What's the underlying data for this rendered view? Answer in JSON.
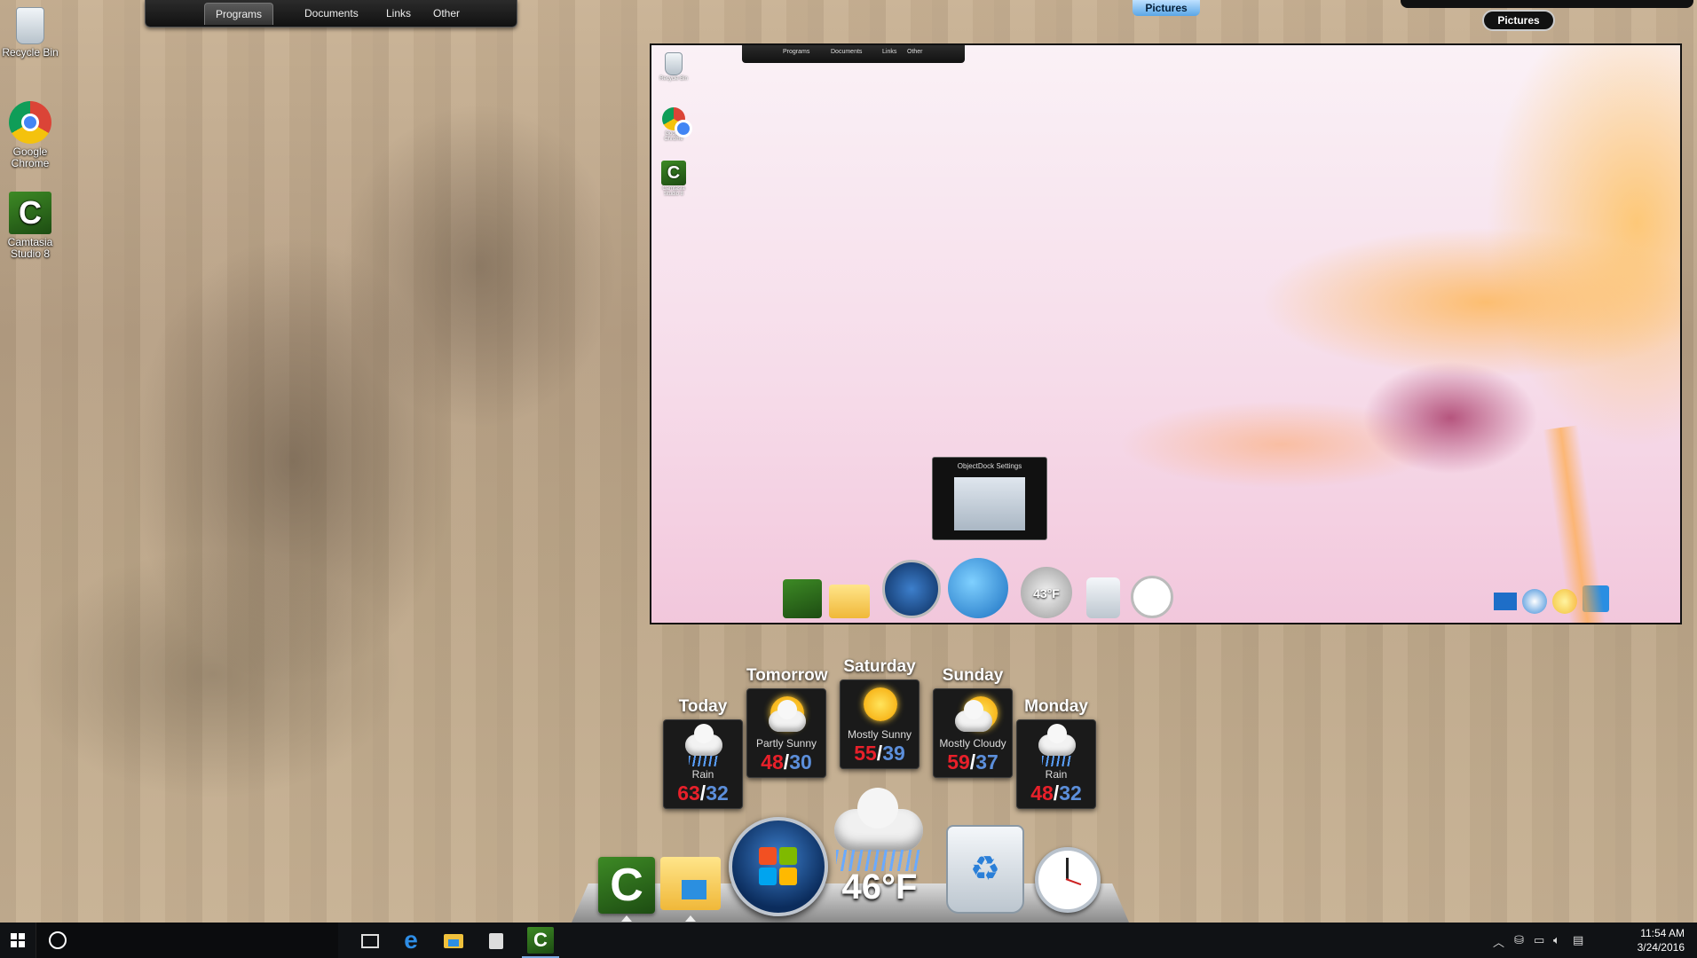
{
  "desktop": {
    "icons": [
      {
        "label": "Recycle Bin",
        "icon": "recycle-bin-icon"
      },
      {
        "label": "Google Chrome",
        "icon": "chrome-icon"
      },
      {
        "label": "Camtasia Studio 8",
        "icon": "camtasia-icon"
      }
    ]
  },
  "top_tabs": [
    "Programs",
    "Documents",
    "Links",
    "Other"
  ],
  "top_right": {
    "pictures_tab": "Pictures",
    "pictures_pill": "Pictures"
  },
  "preview": {
    "mini_tabs": [
      "Programs",
      "Documents",
      "Links",
      "Other"
    ],
    "mini_icons": [
      "Recycle Bin",
      "Google Chrome",
      "Camtasia Studio 8"
    ],
    "tooltip": "ObjectDock Settings",
    "mini_dock_temp": "43°F"
  },
  "forecast": [
    {
      "day": "Today",
      "condition": "Rain",
      "high": "63",
      "low": "32",
      "icon": "rain"
    },
    {
      "day": "Tomorrow",
      "condition": "Partly Sunny",
      "high": "48",
      "low": "30",
      "icon": "partly-sunny"
    },
    {
      "day": "Saturday",
      "condition": "Mostly Sunny",
      "high": "55",
      "low": "39",
      "icon": "sunny"
    },
    {
      "day": "Sunday",
      "condition": "Mostly Cloudy",
      "high": "59",
      "low": "37",
      "icon": "mostly-cloudy"
    },
    {
      "day": "Monday",
      "condition": "Rain",
      "high": "48",
      "low": "32",
      "icon": "rain"
    }
  ],
  "dock": {
    "current_temp": "46°F",
    "items": [
      "camtasia-icon",
      "file-explorer-icon",
      "windows-start-orb-icon",
      "weather-icon",
      "recycle-bin-icon",
      "clock-icon"
    ]
  },
  "taskbar": {
    "time": "11:54 AM",
    "date": "3/24/2016",
    "pinned": [
      "task-view-icon",
      "edge-icon",
      "file-explorer-icon",
      "store-icon",
      "camtasia-icon"
    ]
  },
  "colors": {
    "high_temp": "#e8202a",
    "low_temp": "#5c8fdb",
    "taskbar": "#101215"
  }
}
